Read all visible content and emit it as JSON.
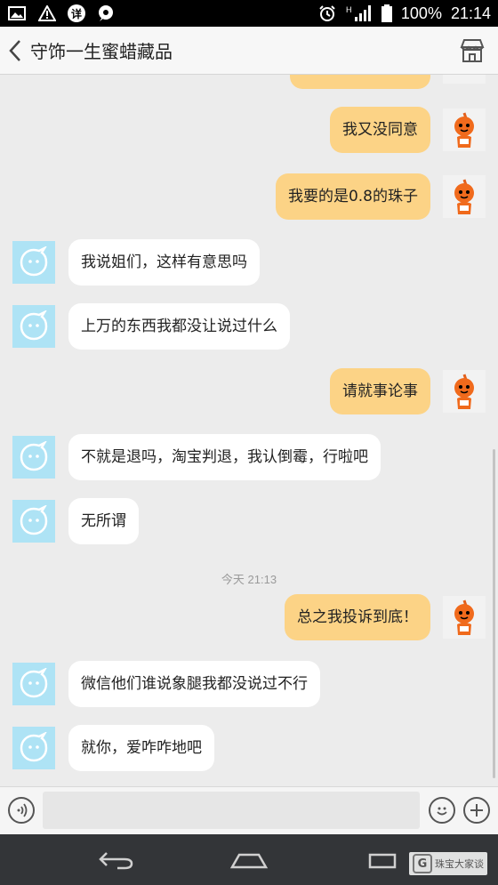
{
  "status_bar": {
    "left_icons": [
      "image-icon",
      "warning-icon",
      "app-badge-icon",
      "chat-notification-icon"
    ],
    "badge_char": "详",
    "battery": "100%",
    "time": "21:14",
    "signal_label": "H"
  },
  "header": {
    "title": "守饰一生蜜蜡藏品",
    "back_icon": "chevron-left-icon",
    "shop_icon": "shop-icon"
  },
  "chat": {
    "messages": [
      {
        "side": "out",
        "text": "我又没同意"
      },
      {
        "side": "out",
        "text": "我要的是0.8的珠子"
      },
      {
        "side": "in",
        "text": "我说姐们，这样有意思吗"
      },
      {
        "side": "in",
        "text": "上万的东西我都没让说过什么"
      },
      {
        "side": "out",
        "text": "请就事论事"
      },
      {
        "side": "in",
        "text": "不就是退吗，淘宝判退，我认倒霉，行啦吧"
      },
      {
        "side": "in",
        "text": "无所谓"
      },
      {
        "side": "out",
        "text": "总之我投诉到底！"
      },
      {
        "side": "in",
        "text": "微信他们谁说象腿我都没说过不行"
      },
      {
        "side": "in",
        "text": "就你，爱咋咋地吧"
      }
    ],
    "timestamp": "今天 21:13"
  },
  "input_bar": {
    "placeholder": "",
    "voice_icon": "voice-icon",
    "emoji_icon": "emoji-icon",
    "plus_icon": "plus-icon"
  },
  "nav_bar": {
    "back_icon": "nav-back-icon",
    "home_icon": "nav-home-icon",
    "recents_icon": "nav-recents-icon"
  },
  "watermark": {
    "logo_char": "G",
    "text": "珠宝大家谈"
  },
  "colors": {
    "outgoing_bubble": "#fcd386",
    "incoming_bubble": "#ffffff",
    "incoming_avatar": "#aee3f5",
    "chat_background": "#ececec"
  }
}
